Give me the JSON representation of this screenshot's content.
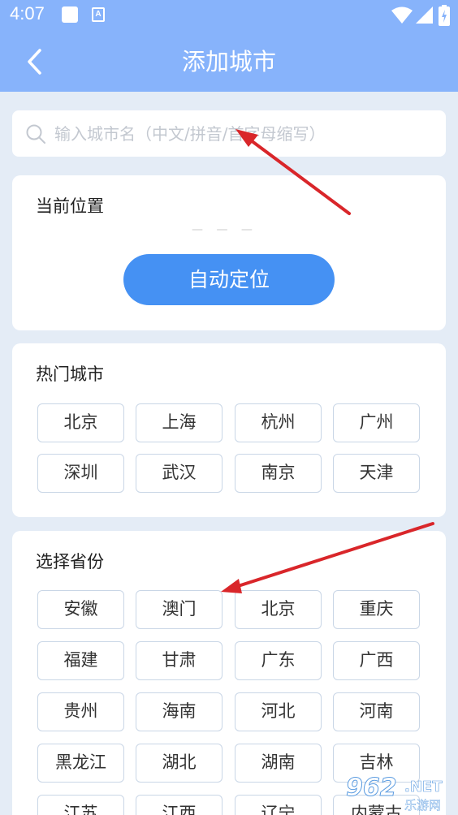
{
  "status_bar": {
    "time": "4:07",
    "a_badge": "A"
  },
  "header": {
    "title": "添加城市",
    "back_icon": "chevron-left-icon"
  },
  "search": {
    "placeholder": "输入城市名（中文/拼音/首字母缩写）",
    "value": ""
  },
  "current_location": {
    "title": "当前位置",
    "value": "— — —",
    "button_label": "自动定位"
  },
  "hot_cities": {
    "title": "热门城市",
    "items": [
      "北京",
      "上海",
      "杭州",
      "广州",
      "深圳",
      "武汉",
      "南京",
      "天津"
    ]
  },
  "provinces": {
    "title": "选择省份",
    "items": [
      "安徽",
      "澳门",
      "北京",
      "重庆",
      "福建",
      "甘肃",
      "广东",
      "广西",
      "贵州",
      "海南",
      "河北",
      "河南",
      "黑龙江",
      "湖北",
      "湖南",
      "吉林",
      "江苏",
      "江西",
      "辽宁",
      "内蒙古"
    ]
  },
  "watermark": {
    "number": "962",
    "suffix": ".NET",
    "text": "乐游网"
  },
  "colors": {
    "header": "#87b3fb",
    "background": "#e4ecf6",
    "button": "#4591f3",
    "arrow": "#d9262a"
  }
}
